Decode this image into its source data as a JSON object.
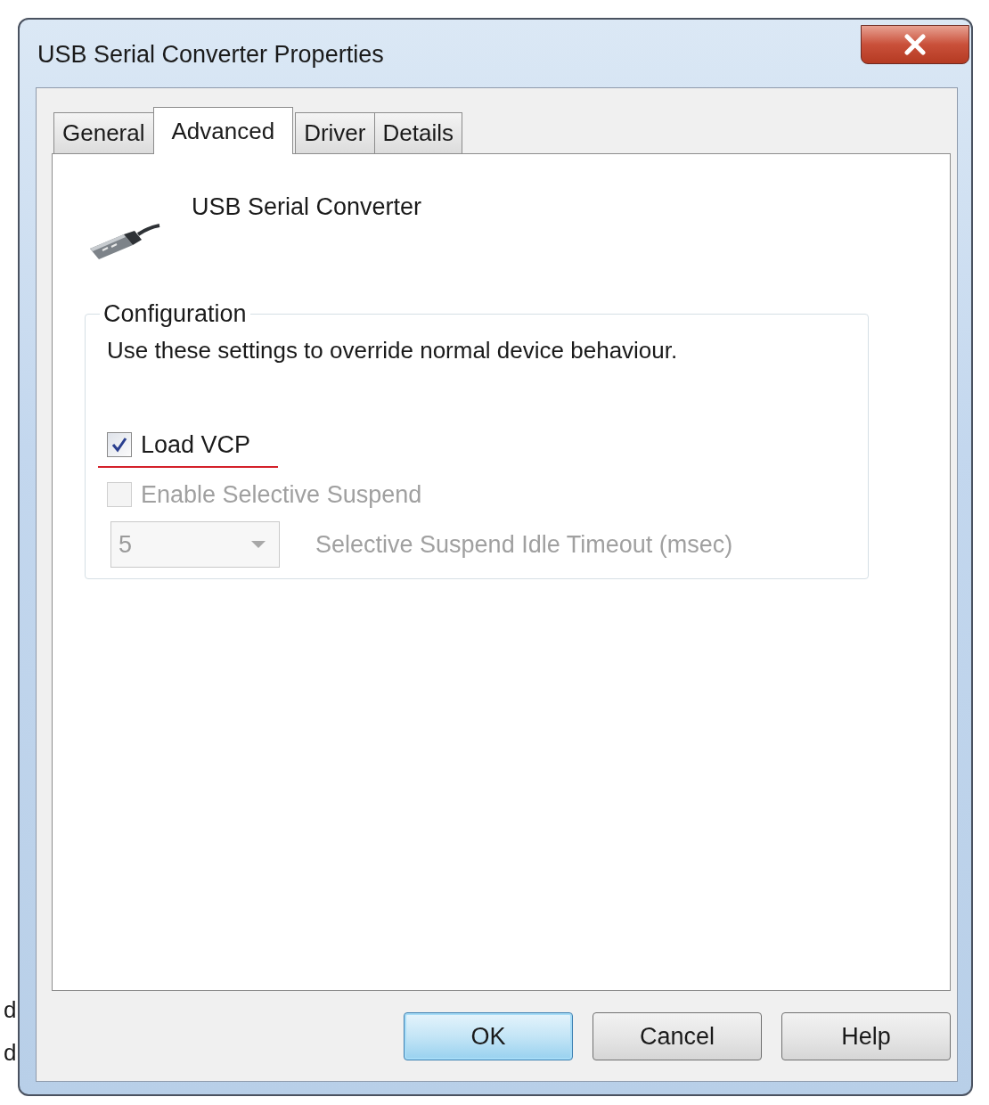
{
  "background_text": [
    "d",
    "d"
  ],
  "window": {
    "title": "USB Serial Converter Properties"
  },
  "tabs": [
    {
      "label": "General",
      "selected": false
    },
    {
      "label": "Advanced",
      "selected": true
    },
    {
      "label": "Driver",
      "selected": false
    },
    {
      "label": "Details",
      "selected": false
    }
  ],
  "device": {
    "name": "USB Serial Converter"
  },
  "configuration": {
    "title": "Configuration",
    "description": "Use these settings to override normal device behaviour.",
    "options": [
      {
        "kind": "checkbox",
        "label": "Load VCP",
        "checked": true,
        "disabled": false,
        "underlined": true
      },
      {
        "kind": "checkbox",
        "label": "Enable Selective Suspend",
        "checked": false,
        "disabled": true,
        "underlined": false
      },
      {
        "kind": "dropdown",
        "value": "5",
        "caption": "Selective Suspend Idle Timeout (msec)",
        "disabled": true,
        "underlined": false
      }
    ]
  },
  "buttons": [
    {
      "label": "OK",
      "default": true
    },
    {
      "label": "Cancel",
      "default": false
    },
    {
      "label": "Help",
      "default": false
    }
  ]
}
